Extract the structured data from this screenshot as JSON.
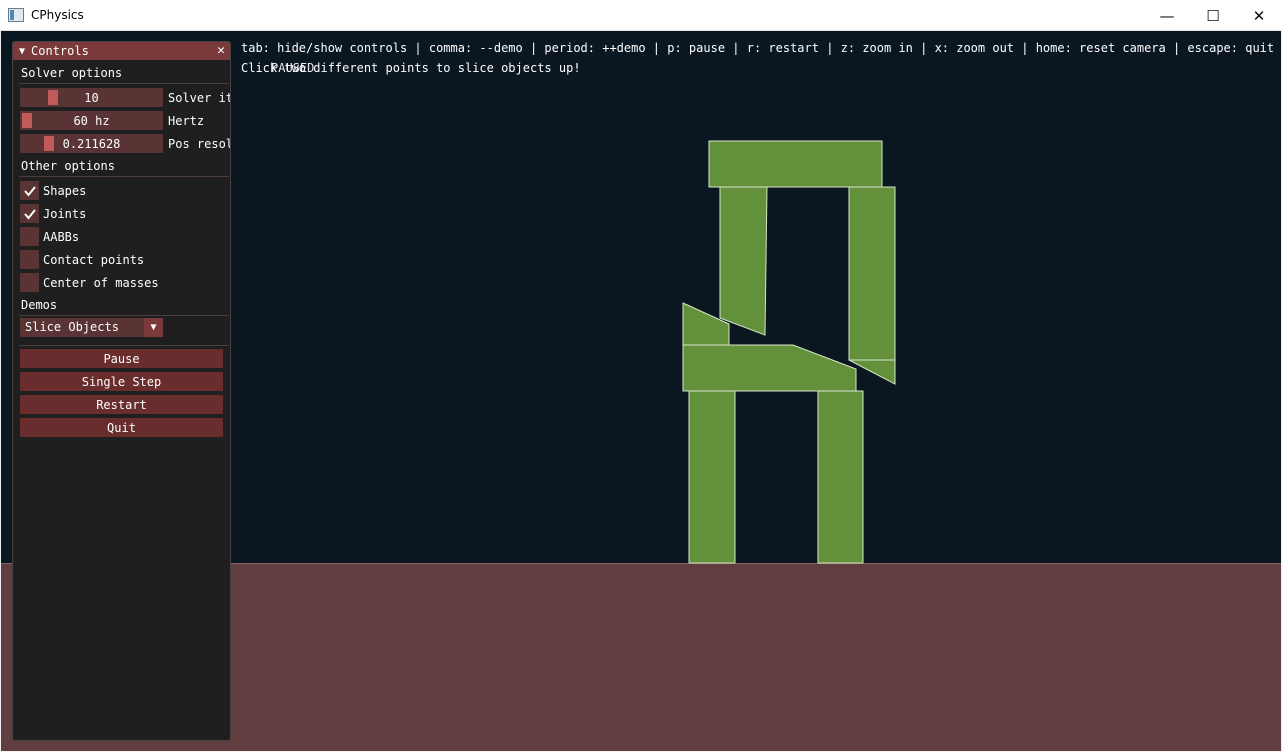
{
  "window": {
    "title": "CPhysics",
    "minimize_glyph": "—",
    "maximize_glyph": "☐",
    "close_glyph": "✕"
  },
  "overlay": {
    "help_text": "tab: hide/show controls | comma: --demo | period: ++demo | p: pause | r: restart | z: zoom in | x: zoom out | home: reset camera | escape: quit",
    "hint_text": "Click two different points to slice objects up!",
    "paused_text": "PAUSED"
  },
  "controls": {
    "title": "Controls",
    "collapse_glyph": "▼",
    "close_glyph": "✕",
    "solver_section": "Solver options",
    "sliders": [
      {
        "value": "10",
        "label": "Solver iterations",
        "fraction": 0.2
      },
      {
        "value": "60 hz",
        "label": "Hertz",
        "fraction": 0.0
      },
      {
        "value": "0.211628",
        "label": "Pos resolution",
        "fraction": 0.17
      }
    ],
    "other_section": "Other options",
    "checkboxes": [
      {
        "label": "Shapes",
        "checked": true
      },
      {
        "label": "Joints",
        "checked": true
      },
      {
        "label": "AABBs",
        "checked": false
      },
      {
        "label": "Contact points",
        "checked": false
      },
      {
        "label": "Center of masses",
        "checked": false
      }
    ],
    "demos_section": "Demos",
    "demo_selected": "Slice Objects",
    "combo_arrow": "▼",
    "buttons": {
      "pause": "Pause",
      "single_step": "Single Step",
      "restart": "Restart",
      "quit": "Quit"
    }
  },
  "colors": {
    "background": "#0a1620",
    "ground": "#603e3f",
    "body_fill": "#62903b",
    "body_outline": "#d8e6c8",
    "accent": "#7a3a3a"
  }
}
